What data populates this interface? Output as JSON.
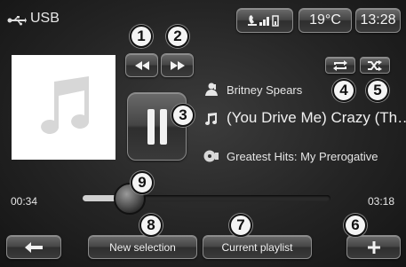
{
  "header": {
    "source_label": "USB",
    "temperature": "19°C",
    "clock": "13:28"
  },
  "track": {
    "artist": "Britney Spears",
    "title": "(You Drive Me) Crazy (Th…",
    "album": "Greatest Hits: My Prerogative"
  },
  "progress": {
    "elapsed": "00:34",
    "total": "03:18",
    "fraction": 0.17
  },
  "footer": {
    "new_selection_label": "New selection",
    "current_playlist_label": "Current playlist"
  },
  "callouts": [
    "1",
    "2",
    "3",
    "4",
    "5",
    "6",
    "7",
    "8",
    "9"
  ],
  "icons": {
    "source": "usb-icon",
    "phone": "phone-signal-icon",
    "album_art": "music-note-icon",
    "prev": "rewind-icon",
    "next": "fast-forward-icon",
    "play_pause": "pause-icon",
    "repeat": "repeat-icon",
    "shuffle": "shuffle-icon",
    "artist": "artist-icon",
    "title": "music-note-icon",
    "album": "disc-icon",
    "back": "back-arrow-icon",
    "add": "plus-icon"
  }
}
